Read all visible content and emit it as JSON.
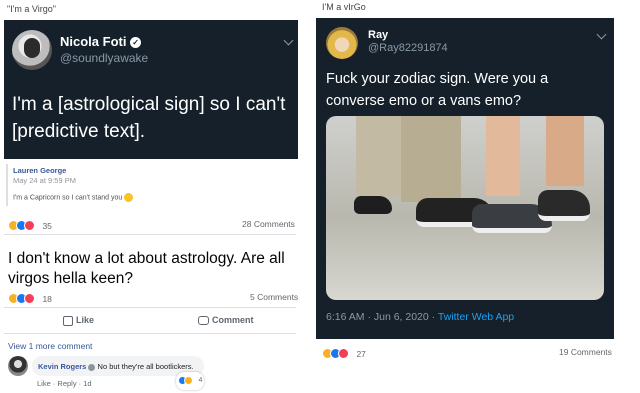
{
  "left": {
    "caption": "\"I'm a Virgo\"",
    "tweet": {
      "name": "Nicola Foti",
      "handle": "@soundlyawake",
      "text": "I'm a [astrological sign] so I can't [predictive text]."
    },
    "quote": {
      "name": "Lauren George",
      "date": "May 24 at 9:59 PM",
      "text": "I'm a Capricorn so I can't stand you"
    },
    "post1": {
      "reaction_count": "35",
      "comments": "28 Comments"
    },
    "post2": {
      "text": "I don't know a lot about astrology. Are all virgos hella keen?",
      "reaction_count": "18",
      "comments": "5 Comments",
      "like_label": "Like",
      "comment_label": "Comment",
      "view_more": "View 1 more comment"
    },
    "reply": {
      "name": "Kevin Rogers",
      "text": "No but they're all bootlickers.",
      "actions": "Like · Reply · 1d",
      "reaction_count": "4"
    }
  },
  "right": {
    "caption": "I'M a vIrGo",
    "tweet": {
      "name": "Ray",
      "handle": "@Ray82291874",
      "text": "Fuck your zodiac sign. Were you a converse emo or a vans emo?",
      "timestamp": "6:16 AM · Jun 6, 2020 · ",
      "source": "Twitter Web App"
    },
    "reaction_count": "27",
    "comments": "19 Comments"
  },
  "colors": {
    "twitter_bg": "#15202b",
    "twitter_link": "#1da1f2",
    "fb_blue": "#385898",
    "like_blue": "#1877f2",
    "love_red": "#f33e58",
    "haha_yellow": "#f7b125"
  }
}
